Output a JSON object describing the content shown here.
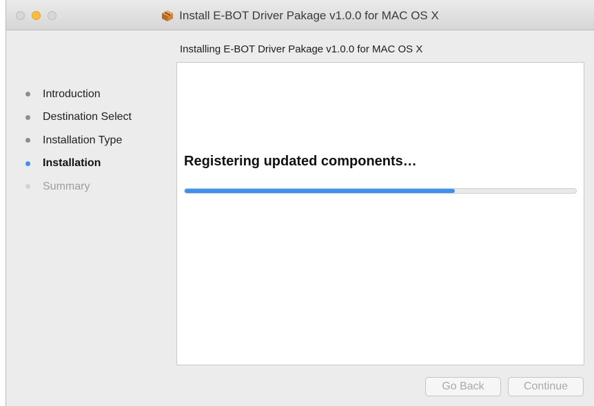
{
  "window": {
    "title": "Install E-BOT Driver Pakage v1.0.0 for MAC OS X",
    "icon": "package-icon"
  },
  "header": {
    "subtitle": "Installing E-BOT Driver Pakage v1.0.0 for MAC OS X"
  },
  "sidebar": {
    "steps": [
      {
        "label": "Introduction",
        "state": "done"
      },
      {
        "label": "Destination Select",
        "state": "done"
      },
      {
        "label": "Installation Type",
        "state": "done"
      },
      {
        "label": "Installation",
        "state": "active"
      },
      {
        "label": "Summary",
        "state": "future"
      }
    ]
  },
  "main": {
    "status": "Registering updated components…",
    "progress": 0.69
  },
  "buttons": {
    "back": "Go Back",
    "continue": "Continue"
  },
  "colors": {
    "accent": "#3d8ff0",
    "minimize": "#fdbc40"
  }
}
